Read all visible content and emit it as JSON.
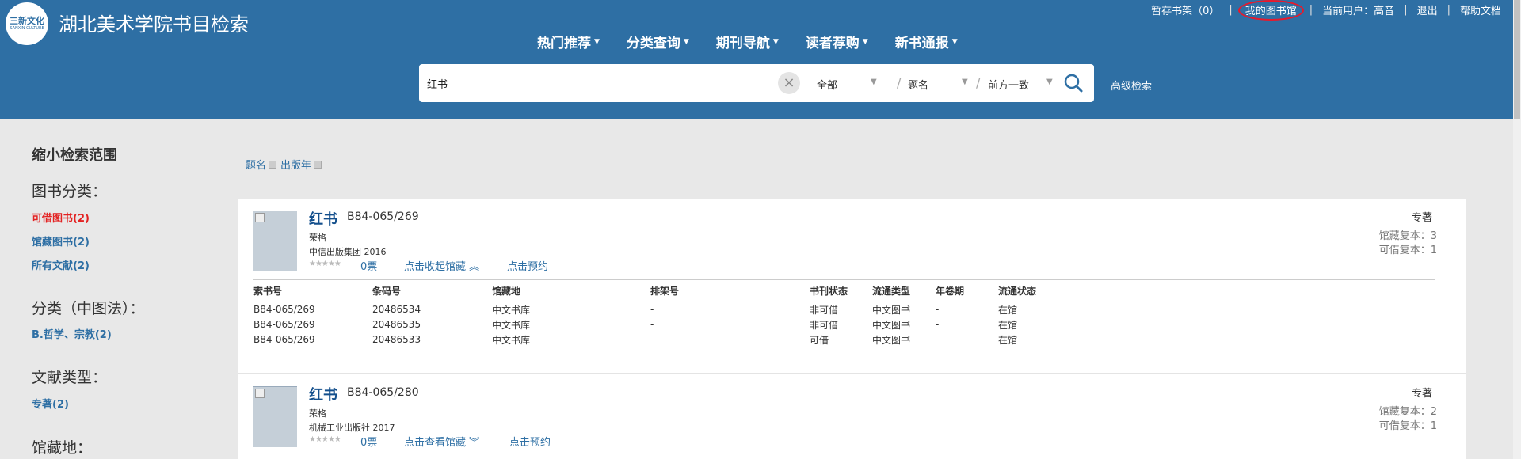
{
  "header": {
    "logo_text": "三新文化",
    "logo_sub": "SANXIN CULTURE",
    "title": "湖北美术学院书目检索",
    "shelf": "暂存书架（0）",
    "my_library": "我的图书馆",
    "current_user": "当前用户：",
    "username": "高音",
    "logout": "退出",
    "help": "帮助文档",
    "nav": [
      "热门推荐",
      "分类查询",
      "期刊导航",
      "读者荐购",
      "新书通报"
    ],
    "search": {
      "value": "红书",
      "scope": "全部",
      "field": "题名",
      "match": "前方一致",
      "advanced": "高级检索"
    }
  },
  "sidebar": {
    "title": "缩小检索范围",
    "sections": [
      {
        "heading": "图书分类：",
        "links": [
          "可借图书(2)",
          "馆藏图书(2)",
          "所有文献(2)"
        ]
      },
      {
        "heading": "分类（中图法）：",
        "links": [
          "B.哲学、宗教(2)"
        ]
      },
      {
        "heading": "文献类型：",
        "links": [
          "专著(2)"
        ]
      },
      {
        "heading": "馆藏地：",
        "links": []
      }
    ]
  },
  "sort": {
    "by_title": "题名",
    "by_year": "出版年"
  },
  "results": [
    {
      "title": "红书",
      "call_no": "B84-065/269",
      "author": "荣格",
      "publisher": "中信出版集团",
      "year": "2016",
      "votes": "0票",
      "toggle": "点击收起馆藏",
      "reserve": "点击预约",
      "type": "专著",
      "holdings_label": "馆藏复本：",
      "holdings": "3",
      "available_label": "可借复本：",
      "available": "1",
      "table": {
        "headers": [
          "索书号",
          "条码号",
          "馆藏地",
          "排架号",
          "书刊状态",
          "流通类型",
          "年卷期",
          "流通状态"
        ],
        "rows": [
          [
            "B84-065/269",
            "20486534",
            "中文书库",
            "-",
            "非可借",
            "中文图书",
            "-",
            "在馆"
          ],
          [
            "B84-065/269",
            "20486535",
            "中文书库",
            "-",
            "非可借",
            "中文图书",
            "-",
            "在馆"
          ],
          [
            "B84-065/269",
            "20486533",
            "中文书库",
            "-",
            "可借",
            "中文图书",
            "-",
            "在馆"
          ]
        ]
      }
    },
    {
      "title": "红书",
      "call_no": "B84-065/280",
      "author": "荣格",
      "publisher": "机械工业出版社",
      "year": "2017",
      "votes": "0票",
      "toggle": "点击查看馆藏",
      "reserve": "点击预约",
      "type": "专著",
      "holdings_label": "馆藏复本：",
      "holdings": "2",
      "available_label": "可借复本：",
      "available": "1"
    }
  ],
  "colors": {
    "header_bg": "#2e6fa4",
    "title_blue": "#134f8c",
    "link_red": "#e32222",
    "highlight_circle": "#e8192c"
  }
}
